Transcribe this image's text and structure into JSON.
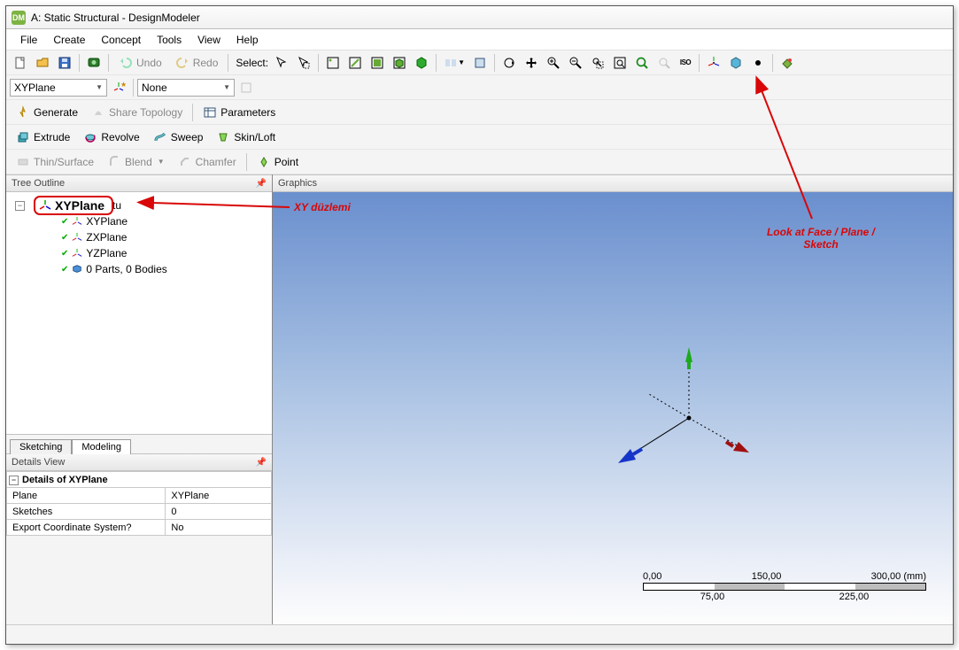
{
  "title": "A: Static Structural - DesignModeler",
  "menu": {
    "file": "File",
    "create": "Create",
    "concept": "Concept",
    "tools": "Tools",
    "view": "View",
    "help": "Help"
  },
  "toolbar1": {
    "undo": "Undo",
    "redo": "Redo",
    "select": "Select:"
  },
  "plane_combo": {
    "value": "XYPlane"
  },
  "sketch_combo": {
    "value": "None"
  },
  "row3": {
    "generate": "Generate",
    "share_topo": "Share Topology",
    "parameters": "Parameters"
  },
  "row4": {
    "extrude": "Extrude",
    "revolve": "Revolve",
    "sweep": "Sweep",
    "skin": "Skin/Loft"
  },
  "row5": {
    "thin": "Thin/Surface",
    "blend": "Blend",
    "chamfer": "Chamfer",
    "point": "Point"
  },
  "tree_outline_hd": "Tree Outline",
  "tree": {
    "root": "XYPlane",
    "root_suffix": "tu",
    "items": [
      "XYPlane",
      "ZXPlane",
      "YZPlane",
      "0 Parts, 0 Bodies"
    ]
  },
  "tabs": {
    "sketching": "Sketching",
    "modeling": "Modeling"
  },
  "details_hd": "Details View",
  "details": {
    "title": "Details of XYPlane",
    "rows": [
      {
        "k": "Plane",
        "v": "XYPlane"
      },
      {
        "k": "Sketches",
        "v": "0"
      },
      {
        "k": "Export Coordinate System?",
        "v": "No"
      }
    ]
  },
  "graphics_hd": "Graphics",
  "scale": {
    "t0": "0,00",
    "t1": "75,00",
    "t2": "150,00",
    "t3": "225,00",
    "t4": "300,00 (mm)"
  },
  "anno1": "XY düzlemi",
  "anno2_a": "Look at Face / Plane /",
  "anno2_b": "Sketch"
}
